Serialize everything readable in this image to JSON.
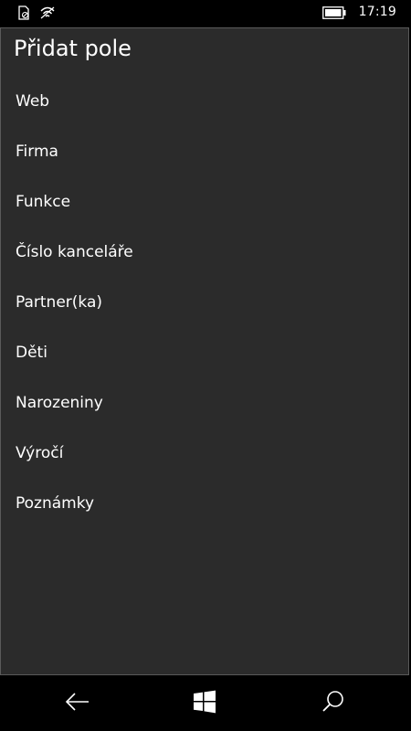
{
  "status_bar": {
    "time": "17:19",
    "icons": [
      "no-sim-icon",
      "wifi-icon",
      "battery-icon"
    ]
  },
  "dialog": {
    "title": "Přidat pole",
    "items": [
      {
        "label": "Web"
      },
      {
        "label": "Firma"
      },
      {
        "label": "Funkce"
      },
      {
        "label": "Číslo kanceláře"
      },
      {
        "label": "Partner(ka)"
      },
      {
        "label": "Děti"
      },
      {
        "label": "Narozeniny"
      },
      {
        "label": "Výročí"
      },
      {
        "label": "Poznámky"
      }
    ]
  },
  "nav_bar": {
    "icons": [
      "back-arrow-icon",
      "windows-logo-icon",
      "search-icon"
    ]
  },
  "colors": {
    "background": "#000000",
    "panel": "#2b2b2b",
    "panel_border": "#5a5a5a",
    "text": "#ffffff"
  }
}
